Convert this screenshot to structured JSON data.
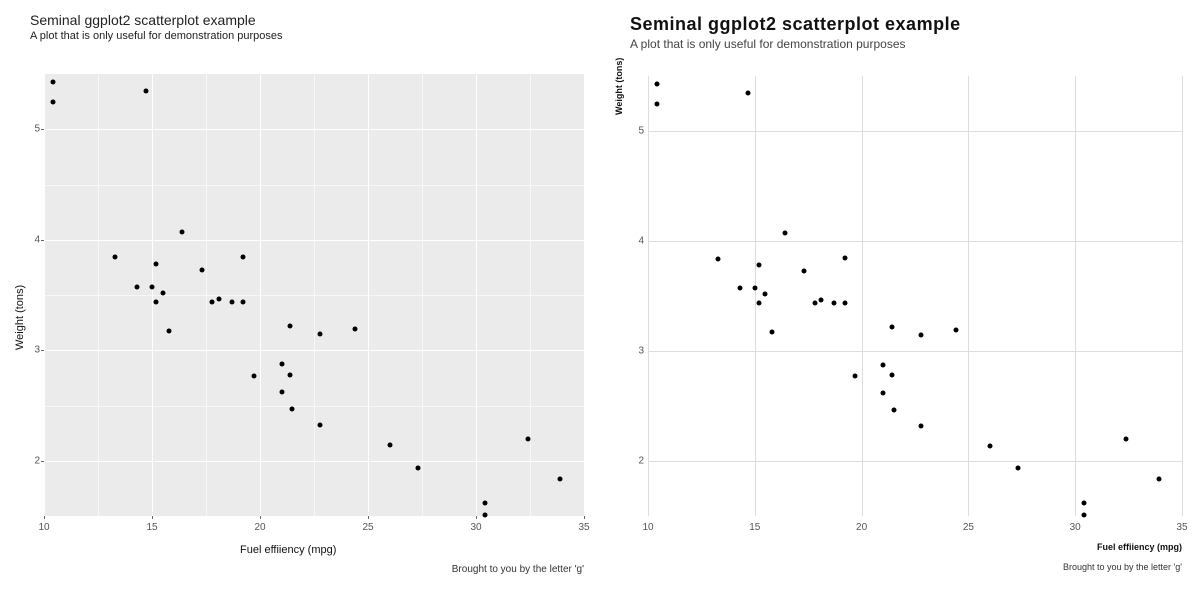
{
  "left": {
    "title": "Seminal ggplot2 scatterplot example",
    "subtitle": "A plot that is only useful for demonstration purposes",
    "xlabel": "Fuel effiiency (mpg)",
    "ylabel": "Weight (tons)",
    "caption": "Brought to you by the letter 'g'"
  },
  "right": {
    "title": "Seminal ggplot2 scatterplot example",
    "subtitle": "A plot that is only useful for demonstration purposes",
    "xlabel": "Fuel effiiency (mpg)",
    "ylabel": "Weight (tons)",
    "caption": "Brought to you by the letter 'g'"
  },
  "chart_data": [
    {
      "type": "scatter",
      "title": "Seminal ggplot2 scatterplot example",
      "subtitle": "A plot that is only useful for demonstration purposes",
      "xlabel": "Fuel effiiency (mpg)",
      "ylabel": "Weight (tons)",
      "xlim": [
        10,
        35
      ],
      "ylim": [
        1.5,
        5.5
      ],
      "xticks": [
        10,
        15,
        20,
        25,
        30,
        35
      ],
      "yticks": [
        2,
        3,
        4,
        5
      ],
      "theme": "ggplot2-grey",
      "caption": "Brought to you by the letter 'g'",
      "points": [
        {
          "x": 21.0,
          "y": 2.62
        },
        {
          "x": 21.0,
          "y": 2.875
        },
        {
          "x": 22.8,
          "y": 2.32
        },
        {
          "x": 21.4,
          "y": 3.215
        },
        {
          "x": 18.7,
          "y": 3.44
        },
        {
          "x": 18.1,
          "y": 3.46
        },
        {
          "x": 14.3,
          "y": 3.57
        },
        {
          "x": 24.4,
          "y": 3.19
        },
        {
          "x": 22.8,
          "y": 3.15
        },
        {
          "x": 19.2,
          "y": 3.44
        },
        {
          "x": 17.8,
          "y": 3.44
        },
        {
          "x": 16.4,
          "y": 4.07
        },
        {
          "x": 17.3,
          "y": 3.73
        },
        {
          "x": 15.2,
          "y": 3.78
        },
        {
          "x": 10.4,
          "y": 5.25
        },
        {
          "x": 10.4,
          "y": 5.424
        },
        {
          "x": 14.7,
          "y": 5.345
        },
        {
          "x": 32.4,
          "y": 2.2
        },
        {
          "x": 30.4,
          "y": 1.615
        },
        {
          "x": 33.9,
          "y": 1.835
        },
        {
          "x": 21.5,
          "y": 2.465
        },
        {
          "x": 15.5,
          "y": 3.52
        },
        {
          "x": 15.2,
          "y": 3.435
        },
        {
          "x": 13.3,
          "y": 3.84
        },
        {
          "x": 19.2,
          "y": 3.845
        },
        {
          "x": 27.3,
          "y": 1.935
        },
        {
          "x": 26.0,
          "y": 2.14
        },
        {
          "x": 30.4,
          "y": 1.513
        },
        {
          "x": 15.8,
          "y": 3.17
        },
        {
          "x": 19.7,
          "y": 2.77
        },
        {
          "x": 15.0,
          "y": 3.57
        },
        {
          "x": 21.4,
          "y": 2.78
        }
      ]
    },
    {
      "type": "scatter",
      "title": "Seminal ggplot2 scatterplot example",
      "subtitle": "A plot that is only useful for demonstration purposes",
      "xlabel": "Fuel effiiency (mpg)",
      "ylabel": "Weight (tons)",
      "xlim": [
        10,
        35
      ],
      "ylim": [
        1.5,
        5.5
      ],
      "xticks": [
        10,
        15,
        20,
        25,
        30,
        35
      ],
      "yticks": [
        2,
        3,
        4,
        5
      ],
      "theme": "ipsum-minimal",
      "caption": "Brought to you by the letter 'g'",
      "points": [
        {
          "x": 21.0,
          "y": 2.62
        },
        {
          "x": 21.0,
          "y": 2.875
        },
        {
          "x": 22.8,
          "y": 2.32
        },
        {
          "x": 21.4,
          "y": 3.215
        },
        {
          "x": 18.7,
          "y": 3.44
        },
        {
          "x": 18.1,
          "y": 3.46
        },
        {
          "x": 14.3,
          "y": 3.57
        },
        {
          "x": 24.4,
          "y": 3.19
        },
        {
          "x": 22.8,
          "y": 3.15
        },
        {
          "x": 19.2,
          "y": 3.44
        },
        {
          "x": 17.8,
          "y": 3.44
        },
        {
          "x": 16.4,
          "y": 4.07
        },
        {
          "x": 17.3,
          "y": 3.73
        },
        {
          "x": 15.2,
          "y": 3.78
        },
        {
          "x": 10.4,
          "y": 5.25
        },
        {
          "x": 10.4,
          "y": 5.424
        },
        {
          "x": 14.7,
          "y": 5.345
        },
        {
          "x": 32.4,
          "y": 2.2
        },
        {
          "x": 30.4,
          "y": 1.615
        },
        {
          "x": 33.9,
          "y": 1.835
        },
        {
          "x": 21.5,
          "y": 2.465
        },
        {
          "x": 15.5,
          "y": 3.52
        },
        {
          "x": 15.2,
          "y": 3.435
        },
        {
          "x": 13.3,
          "y": 3.84
        },
        {
          "x": 19.2,
          "y": 3.845
        },
        {
          "x": 27.3,
          "y": 1.935
        },
        {
          "x": 26.0,
          "y": 2.14
        },
        {
          "x": 30.4,
          "y": 1.513
        },
        {
          "x": 15.8,
          "y": 3.17
        },
        {
          "x": 19.7,
          "y": 2.77
        },
        {
          "x": 15.0,
          "y": 3.57
        },
        {
          "x": 21.4,
          "y": 2.78
        }
      ]
    }
  ]
}
